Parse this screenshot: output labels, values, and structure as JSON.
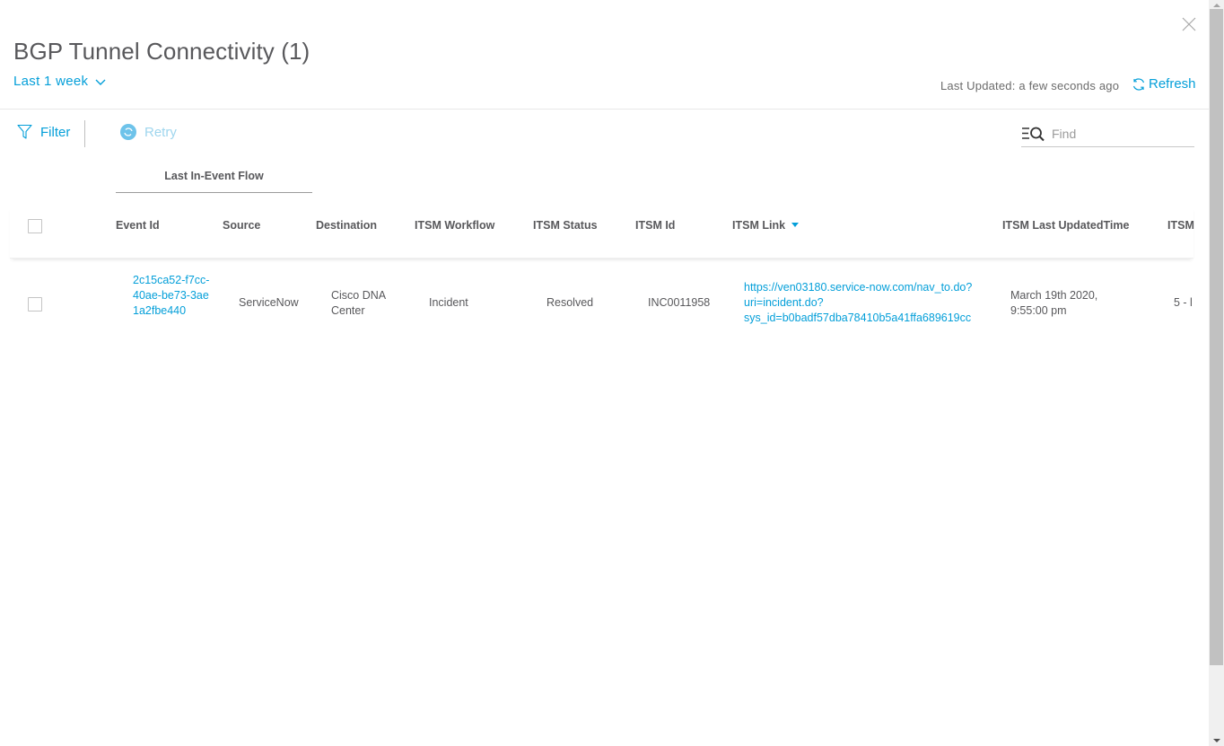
{
  "header": {
    "title": "BGP Tunnel Connectivity (1)",
    "time_range": "Last 1 week",
    "last_updated": "Last Updated: a few seconds ago",
    "refresh_label": "Refresh"
  },
  "toolbar": {
    "filter_label": "Filter",
    "retry_label": "Retry",
    "find_placeholder": "Find",
    "find_value": ""
  },
  "table": {
    "group_header": "Last In-Event Flow",
    "columns": [
      {
        "key": "event_id",
        "label": "Event Id"
      },
      {
        "key": "source",
        "label": "Source"
      },
      {
        "key": "destination",
        "label": "Destination"
      },
      {
        "key": "itsm_workflow",
        "label": "ITSM Workflow"
      },
      {
        "key": "itsm_status",
        "label": "ITSM Status"
      },
      {
        "key": "itsm_id",
        "label": "ITSM Id"
      },
      {
        "key": "itsm_link",
        "label": "ITSM Link",
        "sorted": "descending"
      },
      {
        "key": "itsm_last_updated",
        "label": "ITSM Last UpdatedTime"
      },
      {
        "key": "itsm_more",
        "label": "ITSM"
      }
    ],
    "rows": [
      {
        "selected": false,
        "event_id": "2c15ca52-f7cc-40ae-be73-3ae1a2fbe440",
        "source": "ServiceNow",
        "destination": "Cisco DNA Center",
        "itsm_workflow": "Incident",
        "itsm_status": "Resolved",
        "itsm_id": "INC0011958",
        "itsm_link": "https://ven03180.service-now.com/nav_to.do?uri=incident.do?sys_id=b0badf57dba78410b5a41ffa689619cc",
        "itsm_last_updated": "March 19th 2020, 9:55:00 pm",
        "itsm_more": "5 - l"
      }
    ]
  },
  "colors": {
    "accent": "#049fd9",
    "text": "#58585b",
    "retry_disabled": "#9fd6ee"
  }
}
